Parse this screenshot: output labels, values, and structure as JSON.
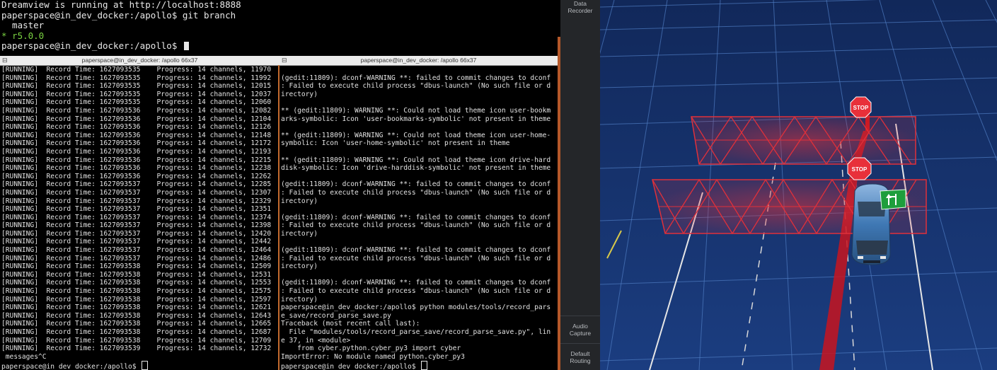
{
  "top_terminal": {
    "lines": [
      "Dreamview is running at http://localhost:8888",
      "paperspace@in_dev_docker:/apollo$ git branch",
      "  master",
      "* r5.0.0",
      "paperspace@in_dev_docker:/apollo$ "
    ]
  },
  "left_pane": {
    "title": "paperspace@in_dev_docker: /apollo 66x37",
    "lines": [
      "[RUNNING]  Record Time: 1627093535    Progress: 14 channels, 11970",
      "[RUNNING]  Record Time: 1627093535    Progress: 14 channels, 11992",
      "[RUNNING]  Record Time: 1627093535    Progress: 14 channels, 12015",
      "[RUNNING]  Record Time: 1627093535    Progress: 14 channels, 12037",
      "[RUNNING]  Record Time: 1627093535    Progress: 14 channels, 12060",
      "[RUNNING]  Record Time: 1627093536    Progress: 14 channels, 12082",
      "[RUNNING]  Record Time: 1627093536    Progress: 14 channels, 12104",
      "[RUNNING]  Record Time: 1627093536    Progress: 14 channels, 12126",
      "[RUNNING]  Record Time: 1627093536    Progress: 14 channels, 12148",
      "[RUNNING]  Record Time: 1627093536    Progress: 14 channels, 12172",
      "[RUNNING]  Record Time: 1627093536    Progress: 14 channels, 12193",
      "[RUNNING]  Record Time: 1627093536    Progress: 14 channels, 12215",
      "[RUNNING]  Record Time: 1627093536    Progress: 14 channels, 12238",
      "[RUNNING]  Record Time: 1627093536    Progress: 14 channels, 12262",
      "[RUNNING]  Record Time: 1627093537    Progress: 14 channels, 12285",
      "[RUNNING]  Record Time: 1627093537    Progress: 14 channels, 12307",
      "[RUNNING]  Record Time: 1627093537    Progress: 14 channels, 12329",
      "[RUNNING]  Record Time: 1627093537    Progress: 14 channels, 12351",
      "[RUNNING]  Record Time: 1627093537    Progress: 14 channels, 12374",
      "[RUNNING]  Record Time: 1627093537    Progress: 14 channels, 12398",
      "[RUNNING]  Record Time: 1627093537    Progress: 14 channels, 12420",
      "[RUNNING]  Record Time: 1627093537    Progress: 14 channels, 12442",
      "[RUNNING]  Record Time: 1627093537    Progress: 14 channels, 12464",
      "[RUNNING]  Record Time: 1627093537    Progress: 14 channels, 12486",
      "[RUNNING]  Record Time: 1627093538    Progress: 14 channels, 12509",
      "[RUNNING]  Record Time: 1627093538    Progress: 14 channels, 12531",
      "[RUNNING]  Record Time: 1627093538    Progress: 14 channels, 12553",
      "[RUNNING]  Record Time: 1627093538    Progress: 14 channels, 12575",
      "[RUNNING]  Record Time: 1627093538    Progress: 14 channels, 12597",
      "[RUNNING]  Record Time: 1627093538    Progress: 14 channels, 12621",
      "[RUNNING]  Record Time: 1627093538    Progress: 14 channels, 12643",
      "[RUNNING]  Record Time: 1627093538    Progress: 14 channels, 12665",
      "[RUNNING]  Record Time: 1627093538    Progress: 14 channels, 12687",
      "[RUNNING]  Record Time: 1627093538    Progress: 14 channels, 12709",
      "[RUNNING]  Record Time: 1627093539    Progress: 14 channels, 12732",
      " messages^C",
      "paperspace@in_dev_docker:/apollo$ "
    ]
  },
  "right_pane": {
    "title": "paperspace@in_dev_docker: /apollo 66x37",
    "lines": [
      "",
      "(gedit:11809): dconf-WARNING **: failed to commit changes to dconf",
      ": Failed to execute child process \"dbus-launch\" (No such file or d",
      "irectory)",
      "",
      "** (gedit:11809): WARNING **: Could not load theme icon user-bookm",
      "arks-symbolic: Icon 'user-bookmarks-symbolic' not present in theme",
      "",
      "** (gedit:11809): WARNING **: Could not load theme icon user-home-",
      "symbolic: Icon 'user-home-symbolic' not present in theme",
      "",
      "** (gedit:11809): WARNING **: Could not load theme icon drive-hard",
      "disk-symbolic: Icon 'drive-harddisk-symbolic' not present in theme",
      "",
      "(gedit:11809): dconf-WARNING **: failed to commit changes to dconf",
      ": Failed to execute child process \"dbus-launch\" (No such file or d",
      "irectory)",
      "",
      "(gedit:11809): dconf-WARNING **: failed to commit changes to dconf",
      ": Failed to execute child process \"dbus-launch\" (No such file or d",
      "irectory)",
      "",
      "(gedit:11809): dconf-WARNING **: failed to commit changes to dconf",
      ": Failed to execute child process \"dbus-launch\" (No such file or d",
      "irectory)",
      "",
      "(gedit:11809): dconf-WARNING **: failed to commit changes to dconf",
      ": Failed to execute child process \"dbus-launch\" (No such file or d",
      "irectory)",
      "paperspace@in_dev_docker:/apollo$ python modules/tools/record_pars",
      "e_save/record_parse_save.py",
      "Traceback (most recent call last):",
      "  File \"modules/tools/record_parse_save/record_parse_save.py\", lin",
      "e 37, in <module>",
      "    from cyber.python.cyber_py3 import cyber",
      "ImportError: No module named python.cyber_py3",
      "paperspace@in_dev_docker:/apollo$ "
    ]
  },
  "side_panel": {
    "data_recorder": "Data\nRecorder",
    "audio_capture": "Audio\nCapture",
    "default_routing": "Default\nRouting"
  },
  "scene": {
    "stop_sign_1": "STOP",
    "stop_sign_2": "STOP",
    "background_color": "#16326e",
    "grid_color": "#5a86c8",
    "fence_color": "#e0303a",
    "routing_color": "#c8141e",
    "turn_sign_color": "#1e9e3c"
  }
}
